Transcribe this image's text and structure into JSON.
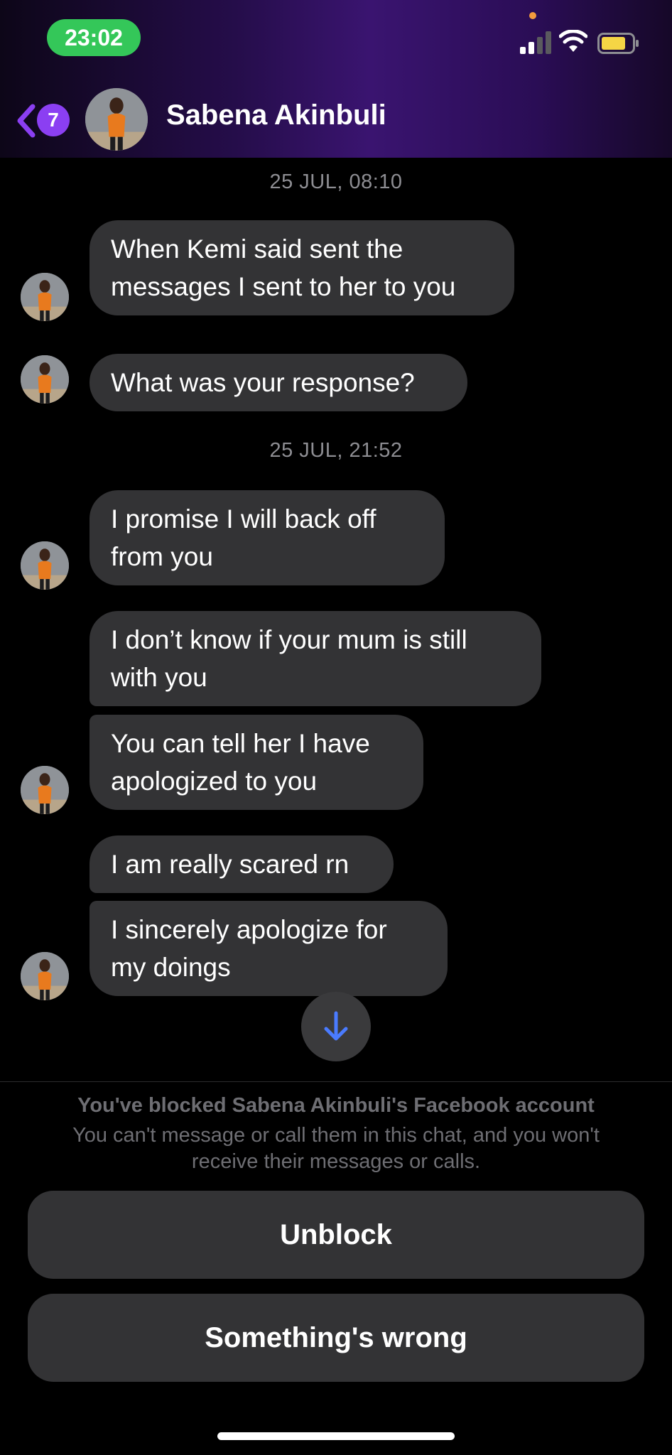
{
  "status_bar": {
    "time": "23:02"
  },
  "header": {
    "back_badge_count": "7",
    "contact_name": "Sabena Akinbuli"
  },
  "conversation": {
    "timestamps": [
      "25 JUL, 08:10",
      "25 JUL, 21:52"
    ],
    "messages": [
      "When Kemi said sent the messages I sent to her to you",
      "What was your response?",
      "I promise I will  back off from you",
      "I don’t know if your mum is still with you",
      "You can tell her I have apologized to you",
      "I am really scared rn",
      "I sincerely apologize for my doings"
    ]
  },
  "blocked_notice": {
    "title": "You've blocked Sabena Akinbuli's Facebook account",
    "description": "You can't message or call them in this chat, and you won't receive their messages or calls."
  },
  "actions": {
    "unblock_label": "Unblock",
    "something_wrong_label": "Something's wrong"
  },
  "colors": {
    "header_gradient": "#3a1470",
    "accent_purple": "#8b3ff2",
    "bubble_bg": "#333335",
    "time_pill": "#34c759",
    "scroll_arrow": "#4a7bff"
  },
  "icons": {
    "back": "chevron-left-icon",
    "scroll": "arrow-down-icon",
    "signal": "signal-icon",
    "wifi": "wifi-icon",
    "battery": "battery-icon"
  }
}
